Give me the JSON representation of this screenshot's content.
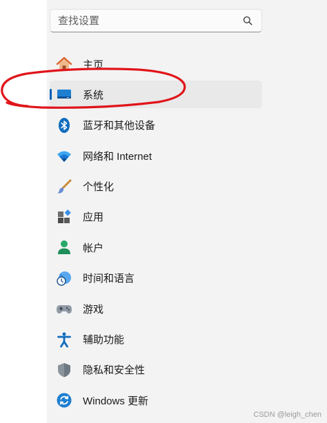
{
  "search": {
    "placeholder": "查找设置",
    "value": ""
  },
  "nav": {
    "items": [
      {
        "id": "home",
        "label": "主页",
        "icon": "home-icon",
        "active": false
      },
      {
        "id": "system",
        "label": "系统",
        "icon": "system-display-icon",
        "active": true
      },
      {
        "id": "bluetooth",
        "label": "蓝牙和其他设备",
        "icon": "bluetooth-icon",
        "active": false
      },
      {
        "id": "network",
        "label": "网络和 Internet",
        "icon": "wifi-icon",
        "active": false
      },
      {
        "id": "personalization",
        "label": "个性化",
        "icon": "paintbrush-icon",
        "active": false
      },
      {
        "id": "apps",
        "label": "应用",
        "icon": "apps-icon",
        "active": false
      },
      {
        "id": "accounts",
        "label": "帐户",
        "icon": "person-icon",
        "active": false
      },
      {
        "id": "time-language",
        "label": "时间和语言",
        "icon": "globe-clock-icon",
        "active": false
      },
      {
        "id": "gaming",
        "label": "游戏",
        "icon": "gamepad-icon",
        "active": false
      },
      {
        "id": "accessibility",
        "label": "辅助功能",
        "icon": "accessibility-icon",
        "active": false
      },
      {
        "id": "privacy",
        "label": "隐私和安全性",
        "icon": "shield-icon",
        "active": false
      },
      {
        "id": "windows-update",
        "label": "Windows 更新",
        "icon": "refresh-icon",
        "active": false
      }
    ]
  },
  "watermark": "CSDN @leigh_chen",
  "colors": {
    "accent": "#005fb8",
    "annotation": "#e0141a",
    "panel": "#f3f3f3"
  }
}
